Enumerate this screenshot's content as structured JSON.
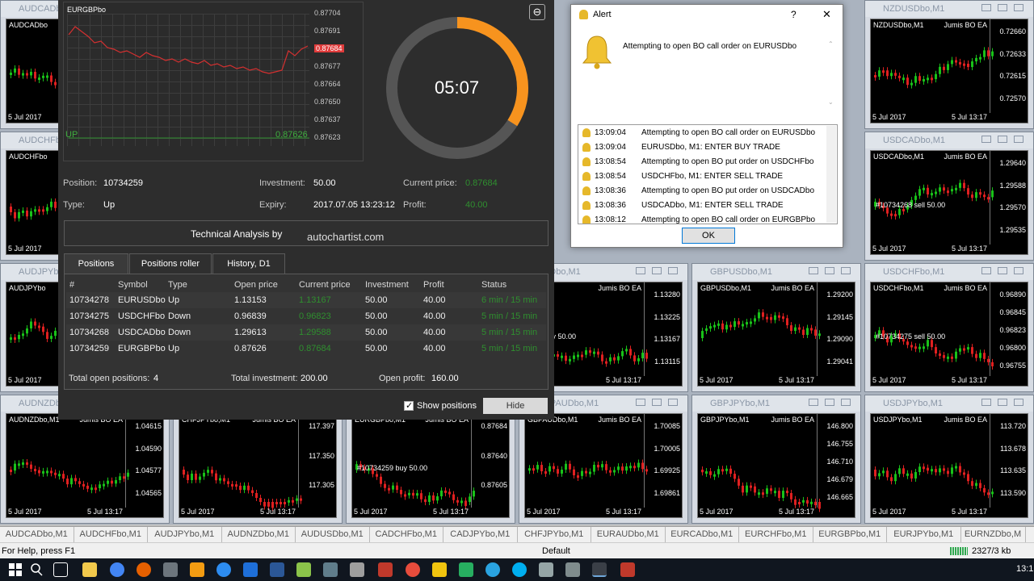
{
  "colors": {
    "accent_orange": "#f7931e",
    "price_red": "#e03b3b",
    "profit_green": "#2f8f2f",
    "panel_bg": "#2d2d2d"
  },
  "charts": [
    {
      "title": "AUDCADbo,M1",
      "sym": "AUDCADbo",
      "ea": "",
      "prices": [],
      "d1": "5 Jul 2017",
      "d2": ""
    },
    {
      "title": "NZDUSDbo,M1",
      "sym": "NZDUSDbo,M1",
      "ea": "Jumis BO EA",
      "prices": [
        "0.72660",
        "0.72633",
        "0.72615",
        "0.72570"
      ],
      "d1": "5 Jul 2017",
      "d2": "5 Jul 13:17"
    },
    {
      "title": "AUDCHFbo",
      "sym": "AUDCHFbo",
      "ea": "",
      "prices": [],
      "d1": "5 Jul 2017",
      "d2": ""
    },
    {
      "title": "USDCADbo,M1",
      "sym": "USDCADbo,M1",
      "ea": "Jumis BO EA",
      "prices": [
        "1.29640",
        "1.29588",
        "1.29570",
        "1.29535"
      ],
      "d1": "5 Jul 2017",
      "d2": "5 Jul 13:17",
      "trade": "#10734268 sell 50.00"
    },
    {
      "title": "AUDJPYbo",
      "sym": "AUDJPYbo",
      "ea": "",
      "prices": [],
      "d1": "5 Jul 2017",
      "d2": ""
    },
    {
      "title": "USDbo,M1",
      "sym": "",
      "ea": "Jumis BO EA",
      "prices": [
        "1.13280",
        "1.13225",
        "1.13167",
        "1.13115"
      ],
      "d1": "",
      "d2": "5 Jul 13:17",
      "trade": "278 buy 50.00"
    },
    {
      "title": "GBPUSDbo,M1",
      "sym": "GBPUSDbo,M1",
      "ea": "Jumis BO EA",
      "prices": [
        "1.29200",
        "1.29145",
        "1.29090",
        "1.29041"
      ],
      "d1": "5 Jul 2017",
      "d2": "5 Jul 13:17"
    },
    {
      "title": "USDCHFbo,M1",
      "sym": "USDCHFbo,M1",
      "ea": "Jumis BO EA",
      "prices": [
        "0.96890",
        "0.96845",
        "0.96823",
        "0.96800",
        "0.96755"
      ],
      "d1": "5 Jul 2017",
      "d2": "5 Jul 13:17",
      "trade": "#10734275 sell 50.00"
    },
    {
      "title": "AUDNZDbo",
      "sym": "AUDNZDbo,M1",
      "ea": "Jumis BO EA",
      "prices": [
        "1.04615",
        "1.04590",
        "1.04577",
        "1.04565"
      ],
      "d1": "5 Jul 2017",
      "d2": "5 Jul 13:17"
    },
    {
      "title": "CHFJPYbo,M1",
      "sym": "CHFJPYbo,M1",
      "ea": "Jumis BO EA",
      "prices": [
        "117.397",
        "117.350",
        "117.305"
      ],
      "d1": "5 Jul 2017",
      "d2": "5 Jul 13:17"
    },
    {
      "title": "EURGBPbo,M1",
      "sym": "EURGBPbo,M1",
      "ea": "Jumis BO EA",
      "prices": [
        "0.87684",
        "0.87640",
        "0.87605"
      ],
      "d1": "5 Jul 2017",
      "d2": "5 Jul 13:17",
      "trade": "#10734259 buy 50.00"
    },
    {
      "title": "GBPAUDbo,M1",
      "sym": "GBPAUDbo,M1",
      "ea": "Jumis BO EA",
      "prices": [
        "1.70085",
        "1.70005",
        "1.69925",
        "1.69861"
      ],
      "d1": "5 Jul 2017",
      "d2": "5 Jul 13:17"
    },
    {
      "title": "GBPJPYbo,M1",
      "sym": "GBPJPYbo,M1",
      "ea": "Jumis BO EA",
      "prices": [
        "146.800",
        "146.755",
        "146.710",
        "146.679",
        "146.665"
      ],
      "d1": "5 Jul 2017",
      "d2": "5 Jul 13:17"
    },
    {
      "title": "USDJPYbo,M1",
      "sym": "USDJPYbo,M1",
      "ea": "Jumis BO EA",
      "prices": [
        "113.720",
        "113.678",
        "113.635",
        "113.590"
      ],
      "d1": "5 Jul 2017",
      "d2": "5 Jul 13:17"
    }
  ],
  "chart_tabs": [
    "AUDCADbo,M1",
    "AUDCHFbo,M1",
    "AUDJPYbo,M1",
    "AUDNZDbo,M1",
    "AUDUSDbo,M1",
    "CADCHFbo,M1",
    "CADJPYbo,M1",
    "CHFJPYbo,M1",
    "EURAUDbo,M1",
    "EURCADbo,M1",
    "EURCHFbo,M1",
    "EURGBPbo,M1",
    "EURJPYbo,M1",
    "EURNZDbo,M"
  ],
  "status": {
    "help": "For Help, press F1",
    "profile": "Default",
    "traffic": "2327/3 kb"
  },
  "taskbar": {
    "clock": "13:1"
  },
  "panel": {
    "mini_chart": {
      "symbol": "EURGBPbo",
      "prices": [
        "0.87704",
        "0.87691",
        "0.87684",
        "0.87677",
        "0.87664",
        "0.87650",
        "0.87637",
        "0.87623"
      ],
      "current_price_tag": "0.87684",
      "direction": "UP",
      "open_price_tag": "0.87626"
    },
    "timer": "05:07",
    "timer_fraction": 0.34,
    "position_label": "Position:",
    "position_value": "10734259",
    "type_label": "Type:",
    "type_value": "Up",
    "investment_label": "Investment:",
    "investment_value": "50.00",
    "expiry_label": "Expiry:",
    "expiry_value": "2017.07.05 13:23:12",
    "current_price_label": "Current price:",
    "current_price_value": "0.87684",
    "profit_label": "Profit:",
    "profit_value": "40.00",
    "ta_label": "Technical Analysis by",
    "ta_brand": "autochartist.com",
    "tabs": [
      "Positions",
      "Positions roller",
      "History, D1"
    ],
    "columns": [
      "#",
      "Symbol",
      "Type",
      "Open price",
      "Current price",
      "Investment",
      "Profit",
      "Status"
    ],
    "rows": [
      [
        "10734278",
        "EURUSDbo",
        "Up",
        "1.13153",
        "1.13167",
        "50.00",
        "40.00",
        "6 min / 15 min"
      ],
      [
        "10734275",
        "USDCHFbo",
        "Down",
        "0.96839",
        "0.96823",
        "50.00",
        "40.00",
        "5 min / 15 min"
      ],
      [
        "10734268",
        "USDCADbo",
        "Down",
        "1.29613",
        "1.29588",
        "50.00",
        "40.00",
        "5 min / 15 min"
      ],
      [
        "10734259",
        "EURGBPbo",
        "Up",
        "0.87626",
        "0.87684",
        "50.00",
        "40.00",
        "5 min / 15 min"
      ]
    ],
    "total_positions_label": "Total open positions:",
    "total_positions_value": "4",
    "total_investment_label": "Total investment:",
    "total_investment_value": "200.00",
    "open_profit_label": "Open profit:",
    "open_profit_value": "160.00",
    "show_positions_label": "Show positions",
    "hide_label": "Hide"
  },
  "alert": {
    "title": "Alert",
    "help": "?",
    "close": "✕",
    "message": "Attempting to open BO call order on EURUSDbo",
    "entries": [
      [
        "13:09:04",
        "Attempting to open BO call order on EURUSDbo"
      ],
      [
        "13:09:04",
        "EURUSDbo, M1: ENTER BUY TRADE"
      ],
      [
        "13:08:54",
        "Attempting to open BO put order on USDCHFbo"
      ],
      [
        "13:08:54",
        "USDCHFbo, M1: ENTER SELL TRADE"
      ],
      [
        "13:08:36",
        "Attempting to open BO put order on USDCADbo"
      ],
      [
        "13:08:36",
        "USDCADbo, M1: ENTER SELL TRADE"
      ],
      [
        "13:08:12",
        "Attempting to open BO call order on EURGBPbo"
      ]
    ],
    "ok_label": "OK"
  }
}
